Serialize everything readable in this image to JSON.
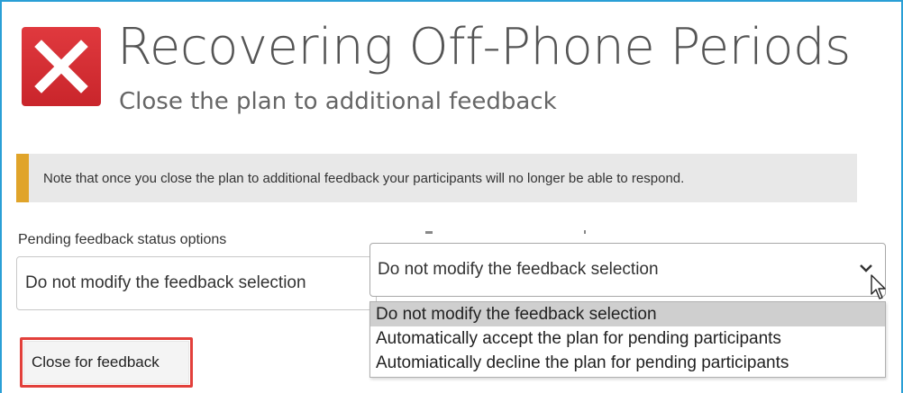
{
  "header": {
    "title": "Recovering Off-Phone Periods",
    "subtitle": "Close the plan to additional feedback",
    "icon": "close-x-icon",
    "icon_color": "#d3292f"
  },
  "note": {
    "text": "Note that once you close the plan to additional feedback your participants will no longer be able to respond.",
    "accent_color": "#e0a42a"
  },
  "pending_status": {
    "label": "Pending feedback status options",
    "value_back": "Do not modify the feedback selection",
    "value": "Do not modify the feedback selection",
    "options": [
      "Do not modify the feedback selection",
      "Automatically accept the plan for pending participants",
      "Automiatically decline the plan for pending participants"
    ],
    "selected_index": 0
  },
  "actions": {
    "close_label": "Close for feedback",
    "highlight_color": "#e2403b"
  }
}
